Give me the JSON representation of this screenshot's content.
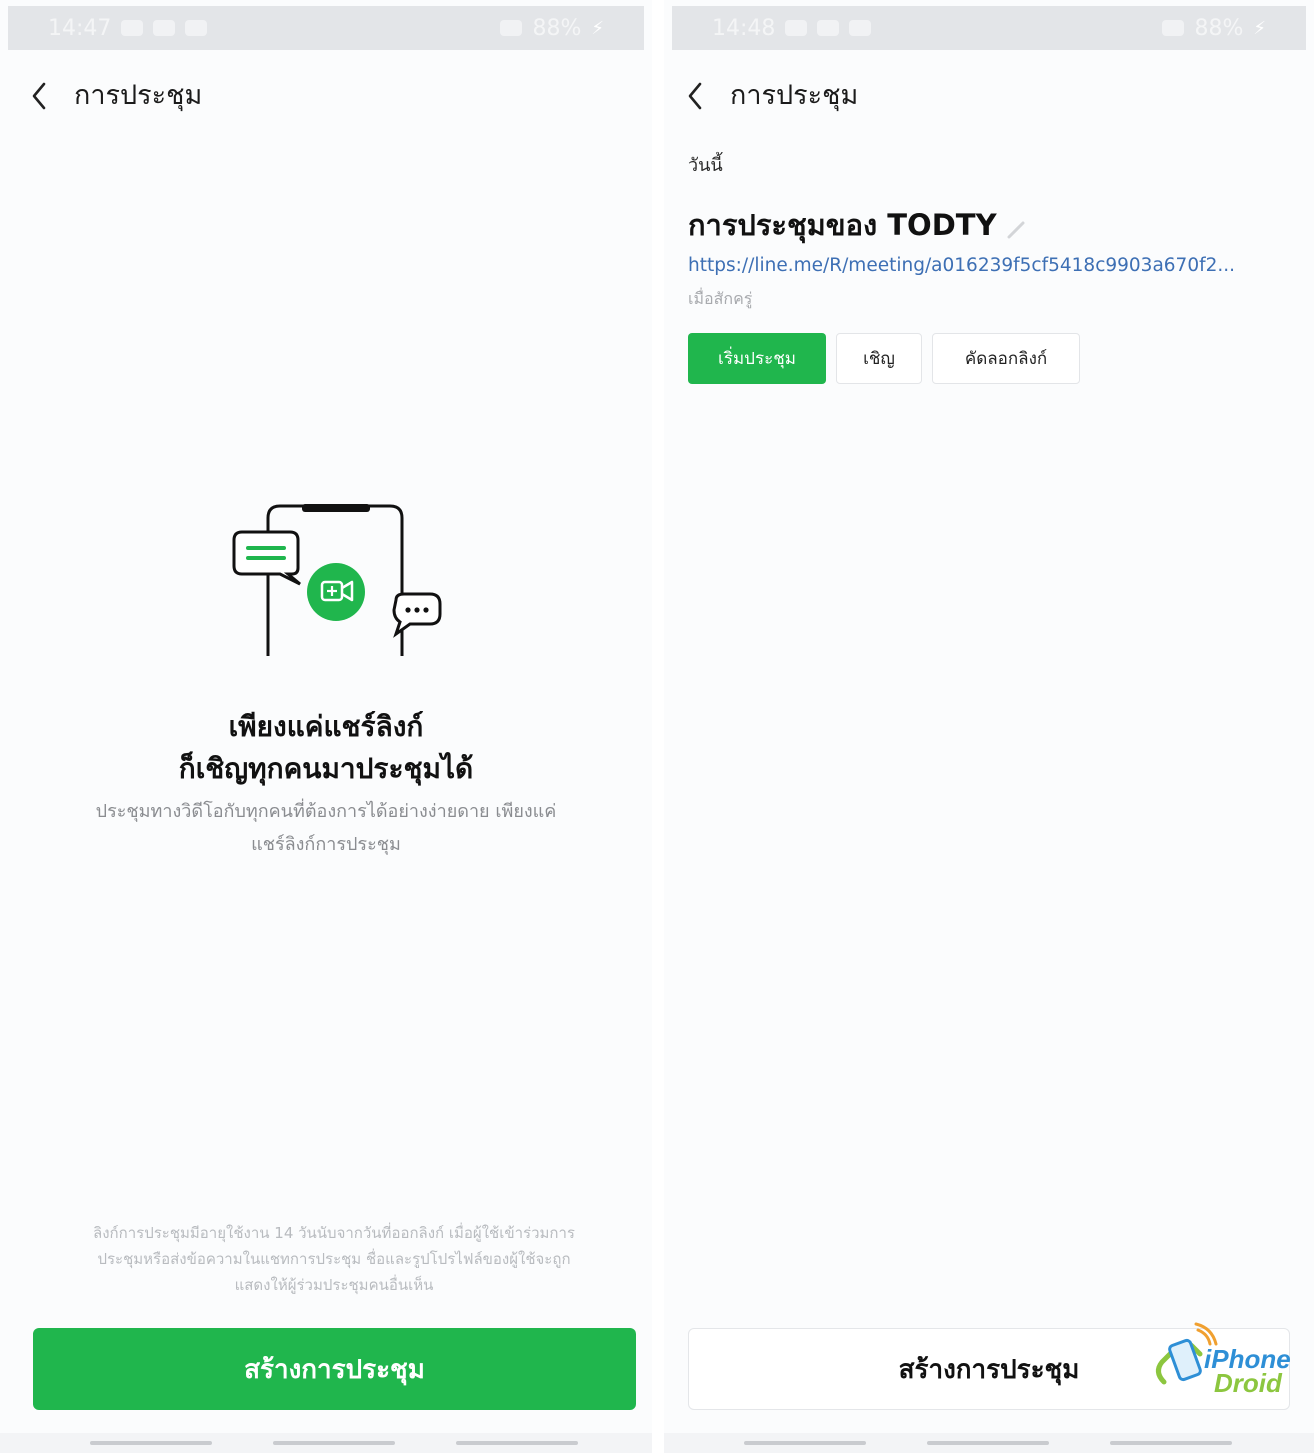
{
  "left_screen": {
    "status_bar": {
      "time": "14:47",
      "battery": "88%"
    },
    "header": {
      "title": "การประชุม"
    },
    "promo": {
      "title_line1": "เพียงแค่แชร์ลิงก์",
      "title_line2": "ก็เชิญทุกคนมาประชุมได้",
      "desc_line1": "ประชุมทางวิดีโอกับทุกคนที่ต้องการได้อย่างง่ายดาย เพียงแค่",
      "desc_line2": "แชร์ลิงก์การประชุม"
    },
    "notice": {
      "line1": "ลิงก์การประชุมมีอายุใช้งาน 14 วันนับจากวันที่ออกลิงก์ เมื่อผู้ใช้เข้าร่วมการ",
      "line2": "ประชุมหรือส่งข้อความในแชทการประชุม ชื่อและรูปโปรไฟล์ของผู้ใช้จะถูก",
      "line3": "แสดงให้ผู้ร่วมประชุมคนอื่นเห็น"
    },
    "create_button": "สร้างการประชุม"
  },
  "right_screen": {
    "status_bar": {
      "time": "14:48",
      "battery": "88%"
    },
    "header": {
      "title": "การประชุม"
    },
    "section_label": "วันนี้",
    "meeting": {
      "title": "การประชุมของ TODTY",
      "link": "https://line.me/R/meeting/a016239f5cf5418c9903a670f2...",
      "host": "เมื่อสักครู่"
    },
    "actions": {
      "start": "เริ่มประชุม",
      "invite": "เชิญ",
      "copy_link": "คัดลอกลิงก์"
    },
    "create_button": "สร้างการประชุม",
    "watermark": {
      "line1": "iPhone",
      "line2": "Droid"
    }
  },
  "colors": {
    "accent_green": "#20b64d",
    "link_blue": "#3d6fb4",
    "muted_text": "#8a8c90"
  },
  "icons": {
    "back": "chevron-left-icon",
    "edit": "pencil-icon",
    "illustration": "phone-video-chat-illustration"
  }
}
